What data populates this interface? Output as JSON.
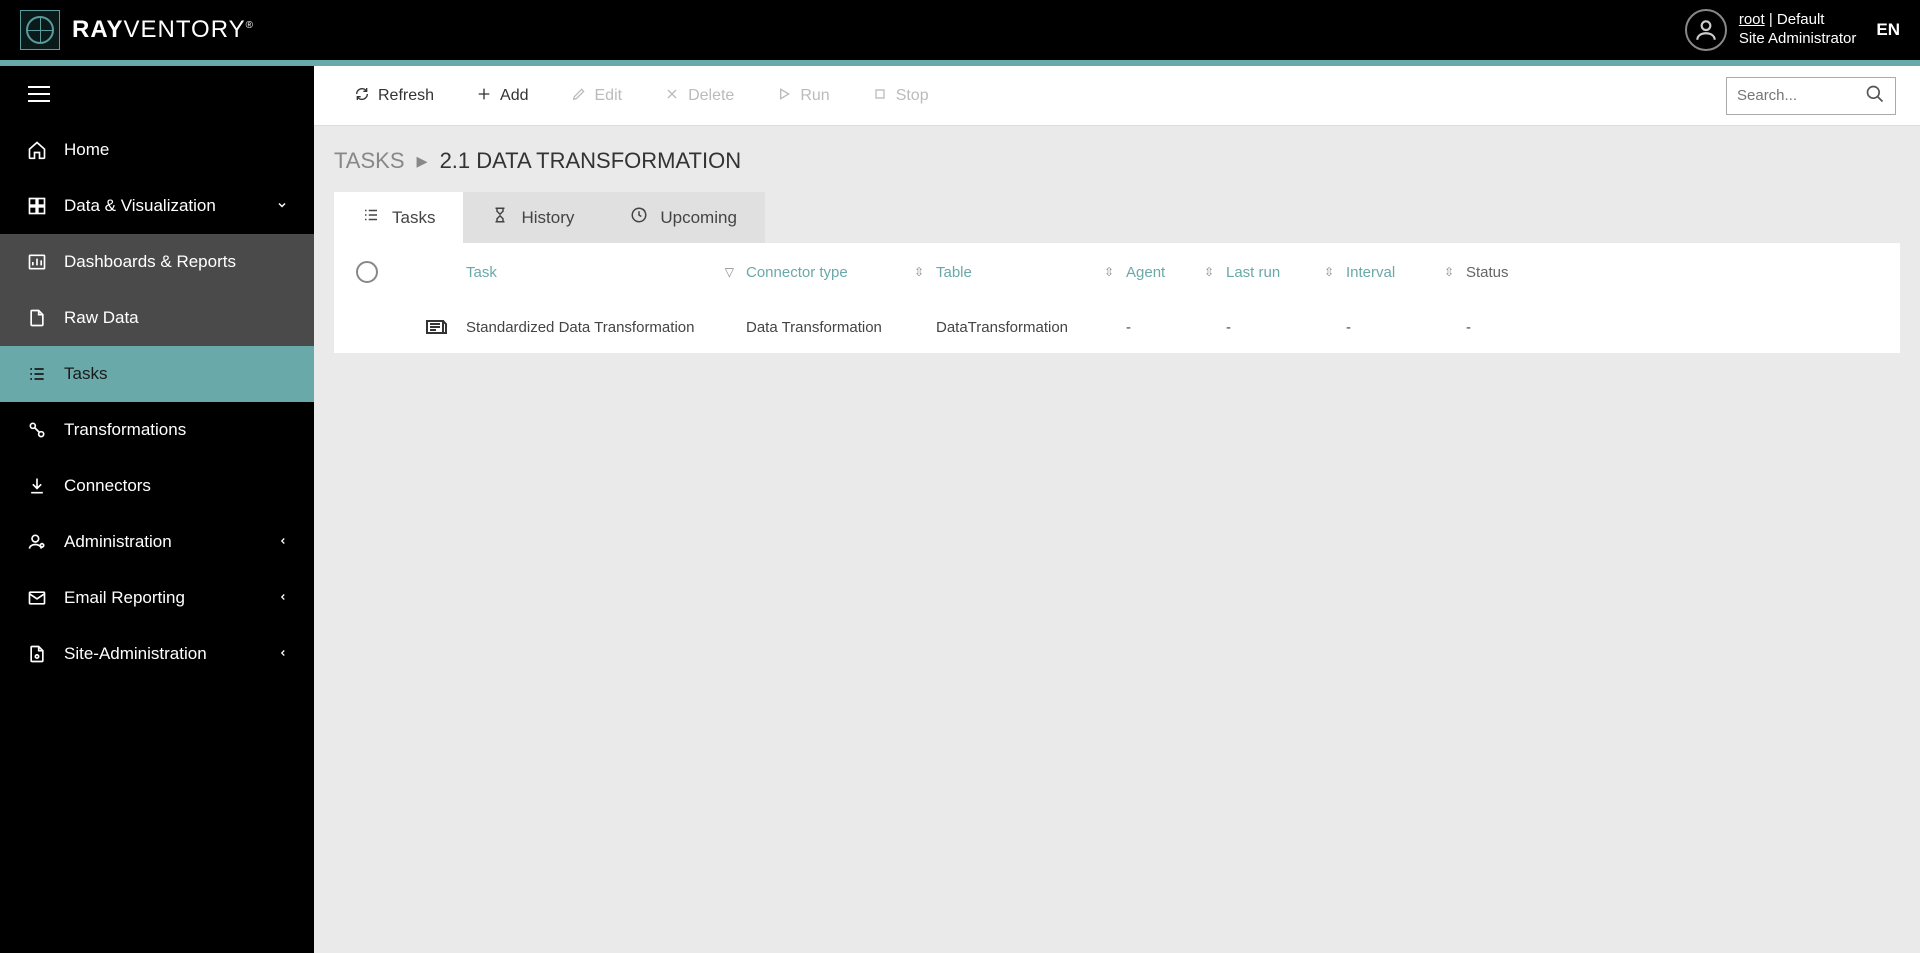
{
  "brand": {
    "bold": "RAY",
    "light": "VENTORY"
  },
  "user": {
    "name": "root",
    "tenant": "Default",
    "role": "Site Administrator"
  },
  "lang": "EN",
  "sidebar": {
    "items": [
      {
        "key": "home",
        "label": "Home"
      },
      {
        "key": "dataviz",
        "label": "Data & Visualization",
        "chevron": "down"
      },
      {
        "key": "dashboards",
        "label": "Dashboards & Reports",
        "sub": true
      },
      {
        "key": "rawdata",
        "label": "Raw Data",
        "sub": true
      },
      {
        "key": "tasks",
        "label": "Tasks",
        "active": true
      },
      {
        "key": "transformations",
        "label": "Transformations"
      },
      {
        "key": "connectors",
        "label": "Connectors"
      },
      {
        "key": "administration",
        "label": "Administration",
        "chevron": "left"
      },
      {
        "key": "emailreporting",
        "label": "Email Reporting",
        "chevron": "left"
      },
      {
        "key": "siteadmin",
        "label": "Site-Administration",
        "chevron": "left"
      }
    ]
  },
  "toolbar": {
    "refresh": "Refresh",
    "add": "Add",
    "edit": "Edit",
    "delete": "Delete",
    "run": "Run",
    "stop": "Stop",
    "search_placeholder": "Search..."
  },
  "breadcrumb": {
    "root": "TASKS",
    "sep": "▸",
    "current": "2.1 DATA TRANSFORMATION"
  },
  "tabs": {
    "tasks": "Tasks",
    "history": "History",
    "upcoming": "Upcoming"
  },
  "grid": {
    "headers": {
      "task": "Task",
      "connector_type": "Connector type",
      "table": "Table",
      "agent": "Agent",
      "last_run": "Last run",
      "interval": "Interval",
      "status": "Status"
    },
    "rows": [
      {
        "task": "Standardized Data Transformation",
        "connector_type": "Data Transformation",
        "table": "DataTransformation",
        "agent": "-",
        "last_run": "-",
        "interval": "-",
        "status": "-"
      }
    ]
  }
}
